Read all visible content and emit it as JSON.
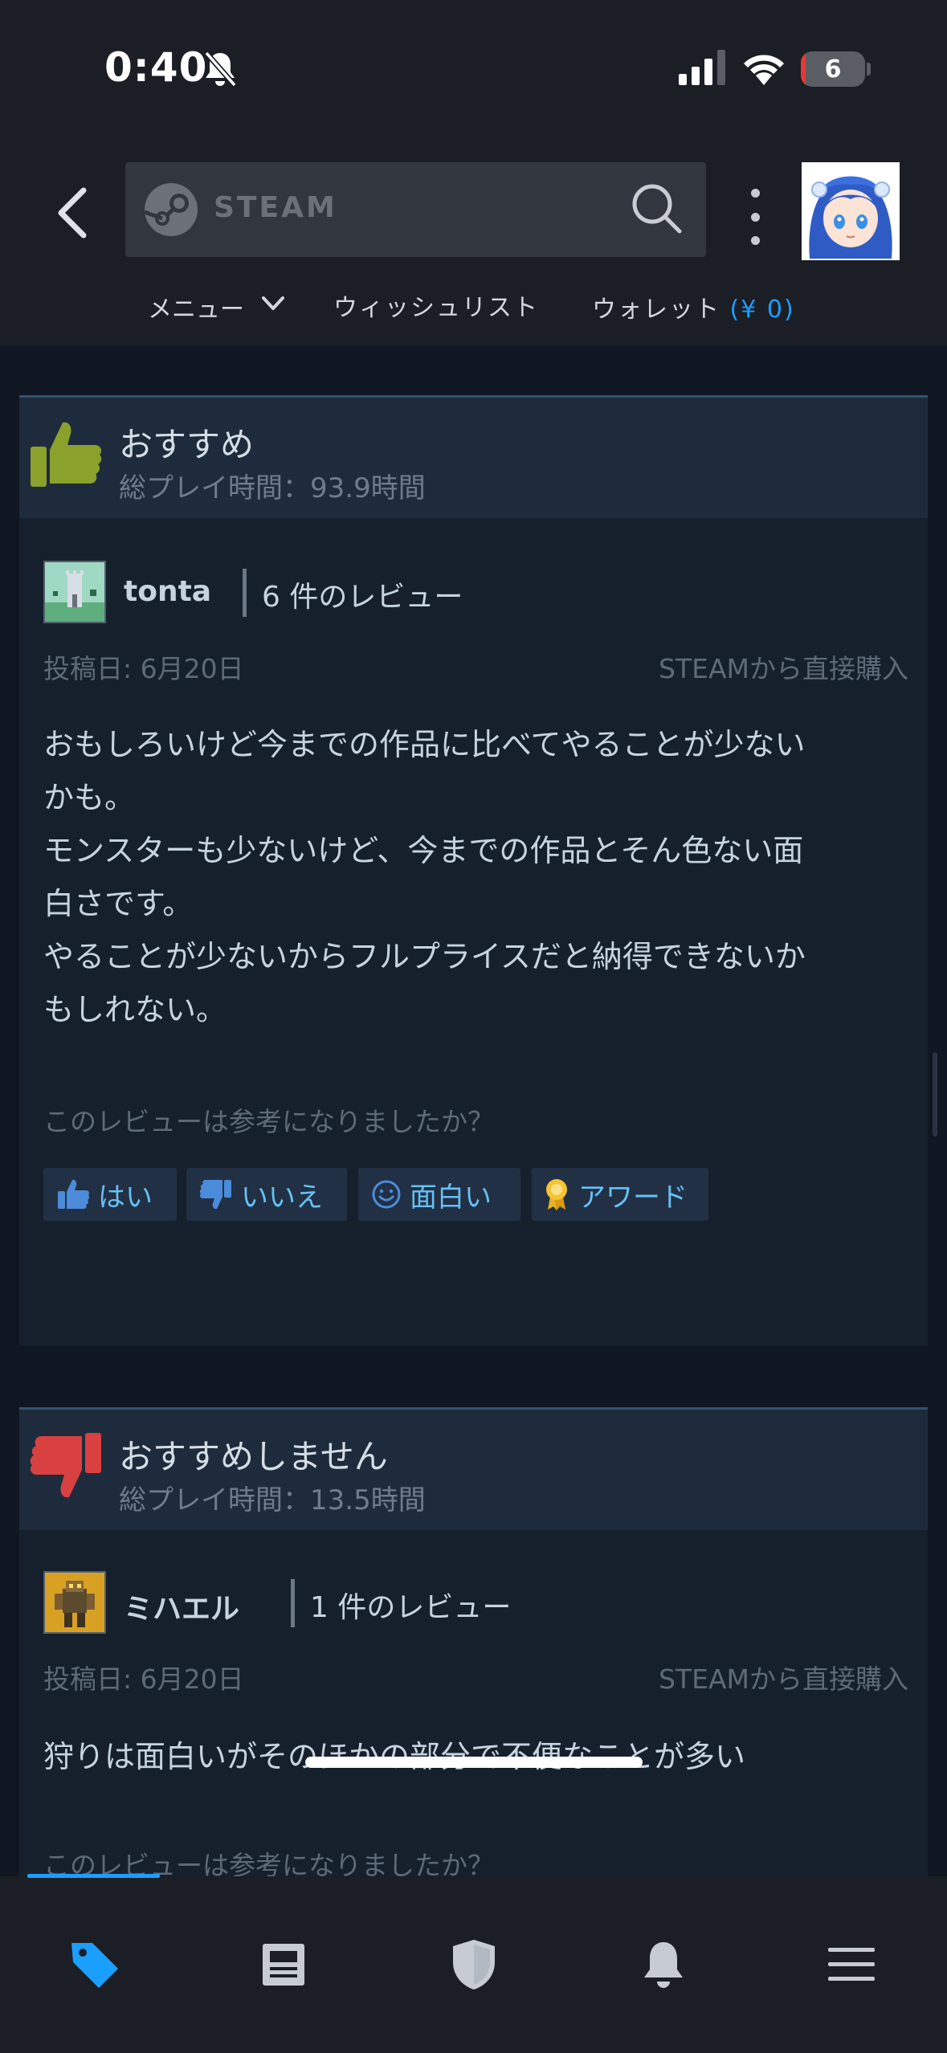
{
  "status_bar": {
    "time": "0:40",
    "battery": "6"
  },
  "header": {
    "search_brand": "STEAM",
    "nav": {
      "menu": "メニュー",
      "wishlist": "ウィッシュリスト",
      "wallet": "ウォレット",
      "wallet_amount": "(¥ 0)"
    }
  },
  "reviews": [
    {
      "recommendation": "おすすめ",
      "playtime": "総プレイ時間：93.9時間",
      "author": "tonta",
      "review_count": "6 件のレビュー",
      "posted": "投稿日: 6月20日",
      "source": "STEAMから直接購入",
      "body_lines": [
        "おもしろいけど今までの作品に比べてやることが少ない",
        "かも。",
        "モンスターも少ないけど、今までの作品とそん色ない面",
        "白さです。",
        "やることが少ないからフルプライスだと納得できないか",
        "もしれない。"
      ],
      "helpful_question": "このレビューは参考になりましたか？",
      "buttons": {
        "yes": "はい",
        "no": "いいえ",
        "funny": "面白い",
        "award": "アワード"
      }
    },
    {
      "recommendation": "おすすめしません",
      "playtime": "総プレイ時間：13.5時間",
      "author": "ミハエル",
      "review_count": "1 件のレビュー",
      "posted": "投稿日: 6月20日",
      "source": "STEAMから直接購入",
      "body_lines": [
        "狩りは面白いがそのほかの部分で不便なことが多い"
      ],
      "helpful_question": "このレビューは参考になりましたか？"
    }
  ],
  "colors": {
    "accent": "#1a9fff",
    "thumb_up": "#8aa12b",
    "thumb_down": "#d94141",
    "link_blue": "#66c0f4"
  },
  "bottom_nav": [
    "store-tag-icon",
    "news-icon",
    "guard-shield-icon",
    "notifications-bell-icon",
    "hamburger-menu-icon"
  ]
}
